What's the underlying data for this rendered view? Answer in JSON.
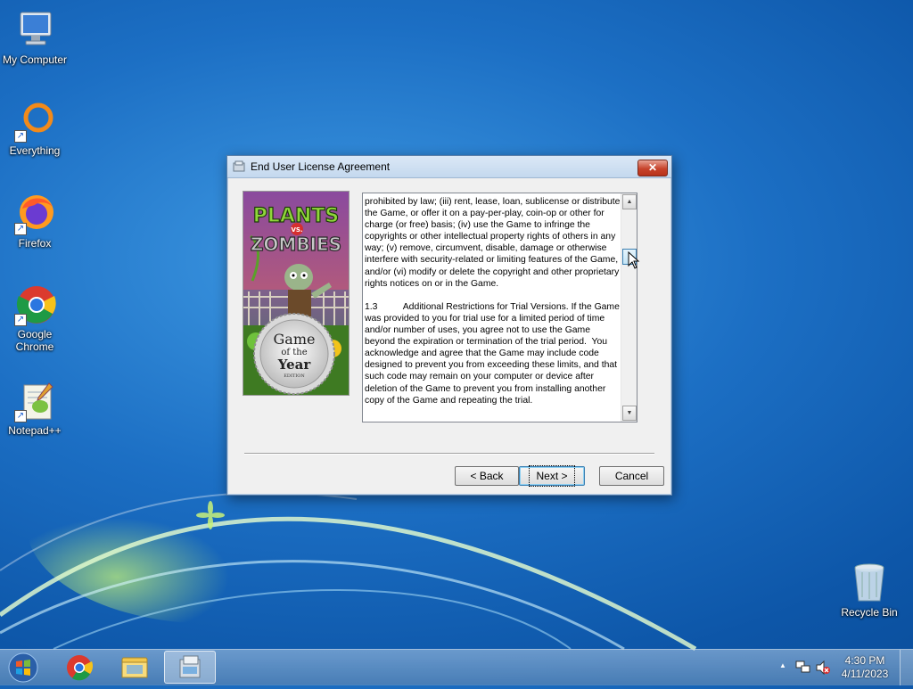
{
  "desktop": {
    "icons": [
      {
        "label": "My Computer"
      },
      {
        "label": "Everything"
      },
      {
        "label": "Firefox"
      },
      {
        "label": "Google Chrome"
      },
      {
        "label": "Notepad++"
      },
      {
        "label": "Recycle Bin"
      }
    ]
  },
  "dialog": {
    "title": "End User License Agreement",
    "close_label": "✕",
    "cover": {
      "logo_top": "PLANTS",
      "logo_vs": "VS.",
      "logo_bottom": "ZOMBIES",
      "seal_line1": "Game",
      "seal_line2": "of the",
      "seal_line3": "Year",
      "seal_line4": "EDITION"
    },
    "license_text": "prohibited by law; (iii) rent, lease, loan, sublicense or distribute the Game, or offer it on a pay-per-play, coin-op or other for charge (or free) basis; (iv) use the Game to infringe the copyrights or other intellectual property rights of others in any way; (v) remove, circumvent, disable, damage or otherwise interfere with security-related or limiting features of the Game, and/or (vi) modify or delete the copyright and other proprietary rights notices on or in the Game.\n\n1.3          Additional Restrictions for Trial Versions. If the Game was provided to you for trial use for a limited period of time and/or number of uses, you agree not to use the Game beyond the expiration or termination of the trial period.  You acknowledge and agree that the Game may include code designed to prevent you from exceeding these limits, and that such code may remain on your computer or device after deletion of the Game to prevent you from installing another copy of the Game and repeating the trial.",
    "buttons": {
      "back": "< Back",
      "next": "Next >",
      "cancel": "Cancel"
    }
  },
  "taskbar": {
    "time": "4:30 PM",
    "date": "4/11/2023",
    "tray_up_arrow": "▲"
  }
}
